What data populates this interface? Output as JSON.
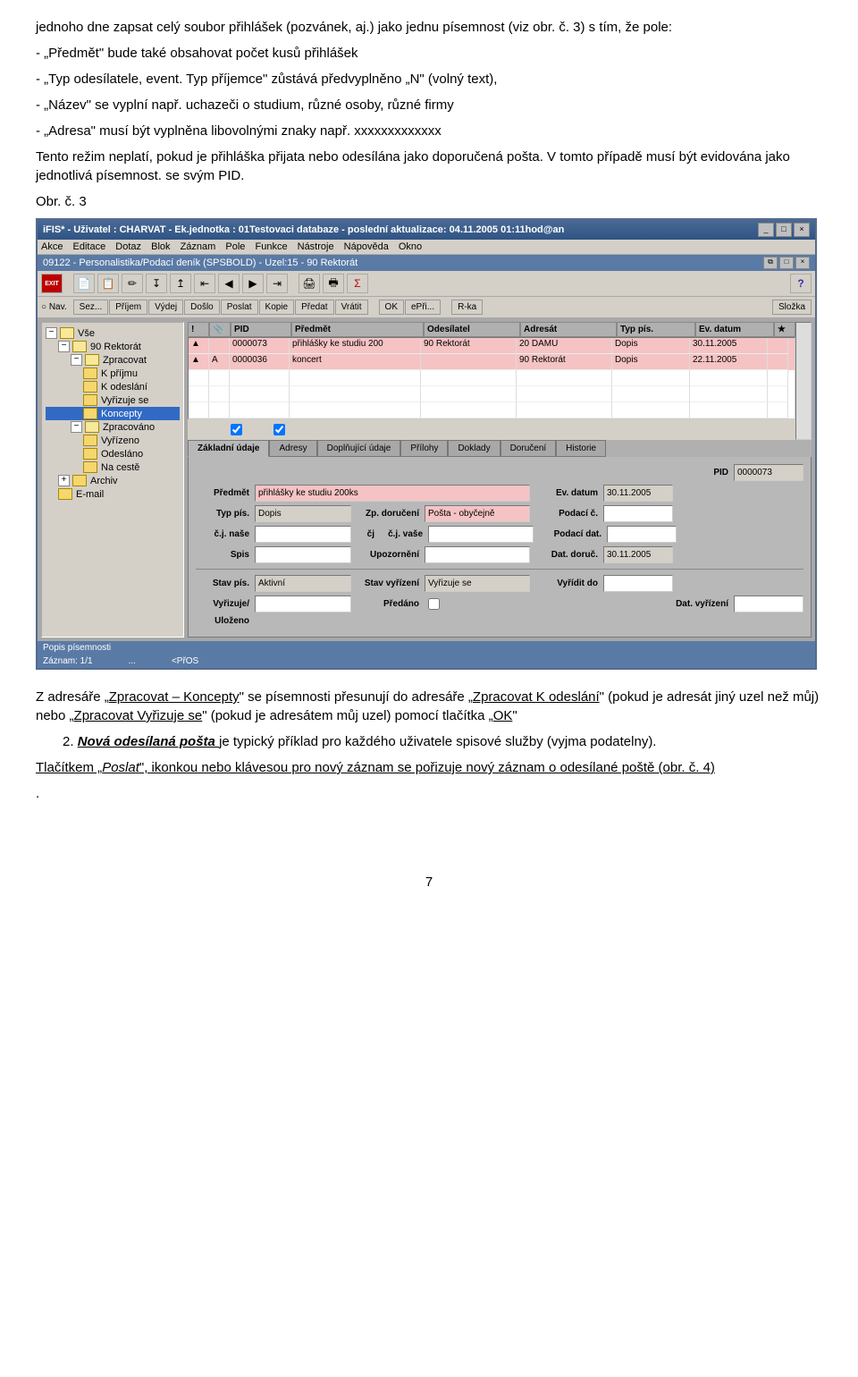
{
  "doc": {
    "p1": "jednoho dne zapsat celý soubor přihlášek (pozvánek, aj.) jako jednu písemnost (viz obr. č. 3) s tím, že pole:",
    "p2": "- „Předmět\" bude také obsahovat počet kusů přihlášek",
    "p3": "- „Typ odesílatele, event. Typ příjemce\" zůstává předvyplněno „N\" (volný text),",
    "p4": "- „Název\" se vyplní např. uchazeči o studium, různé osoby, různé firmy",
    "p5": "- „Adresa\" musí být vyplněna libovolnými znaky např. xxxxxxxxxxxxx",
    "p6": "Tento režim neplatí, pokud je přihláška přijata nebo odesílána jako doporučená pošta. V tomto případě musí být evidována jako jednotlivá písemnost. se svým PID.",
    "p7": "Obr. č. 3",
    "p8a": "Z adresáře „",
    "p8b": "Zpracovat – Koncepty",
    "p8c": "\" se písemnosti přesunují do adresáře „",
    "p8d": "Zpracovat K odeslání",
    "p8e": "\" (pokud je adresát jiný uzel než můj) nebo „",
    "p8f": "Zpracovat Vyřizuje se",
    "p8g": "\" (pokud je adresátem můj uzel) pomocí tlačítka „",
    "p8h": "OK",
    "p8i": "\"",
    "p9a": "2. ",
    "p9b": "Nová odesílaná pošta ",
    "p9c": "je typický příklad pro každého uživatele spisové služby (vyjma podatelny).",
    "p10a": "Tlačítkem „",
    "p10b": "Poslat",
    "p10c": "\", ikonkou nebo klávesou pro nový záznam se pořizuje nový záznam o odesílané poště (obr. č. 4)",
    "p11": ".",
    "pagenum": "7"
  },
  "app": {
    "title": "iFIS* - Uživatel : CHARVAT - Ek.jednotka : 01Testovaci databaze - poslední aktualizace: 04.11.2005 01:11hod@an",
    "menu": [
      "Akce",
      "Editace",
      "Dotaz",
      "Blok",
      "Záznam",
      "Pole",
      "Funkce",
      "Nástroje",
      "Nápověda",
      "Okno"
    ],
    "subtitle": "09122 - Personalistika/Podací deník (SPSBOLD) - Uzel:15 - 90 Rektorát",
    "nav_label": "Nav.",
    "actions": [
      "Sez...",
      "Příjem",
      "Výdej",
      "Došlo",
      "Poslat",
      "Kopie",
      "Předat",
      "Vrátit",
      "OK",
      "ePři...",
      "R-ka",
      "Složka"
    ],
    "tree": {
      "root": "Vše",
      "n1": "90 Rektorát",
      "n2": "Zpracovat",
      "n2a": "K příjmu",
      "n2b": "K odeslání",
      "n2c": "Vyřizuje se",
      "n2d": "Koncepty",
      "n3": "Zpracováno",
      "n3a": "Vyřízeno",
      "n3b": "Odesláno",
      "n3c": "Na cestě",
      "n4": "Archiv",
      "n5": "E-mail"
    },
    "grid": {
      "headers": {
        "warn": "!",
        "clip": "📎",
        "pid": "PID",
        "pred": "Předmět",
        "odes": "Odesílatel",
        "adr": "Adresát",
        "typ": "Typ pís.",
        "ev": "Ev. datum",
        "star": "★"
      },
      "rows": [
        {
          "warn": "▲",
          "clip": "",
          "pid": "0000073",
          "pred": "přihlášky ke studiu 200",
          "odes": "90 Rektorát",
          "adr": "20 DAMU",
          "typ": "Dopis",
          "ev": "30.11.2005"
        },
        {
          "warn": "▲",
          "clip": "A",
          "pid": "0000036",
          "pred": "koncert",
          "odes": "",
          "adr": "90 Rektorát",
          "typ": "Dopis",
          "ev": "22.11.2005"
        }
      ]
    },
    "tabs": [
      "Základní údaje",
      "Adresy",
      "Doplňující údaje",
      "Přílohy",
      "Doklady",
      "Doručení",
      "Historie"
    ],
    "form": {
      "l_pid": "PID",
      "v_pid": "0000073",
      "l_predmet": "Předmět",
      "v_predmet": "přihlášky ke studiu 200ks",
      "l_evdatum": "Ev. datum",
      "v_evdatum": "30.11.2005",
      "l_typpis": "Typ pís.",
      "v_typpis": "Dopis",
      "l_zpdor": "Zp. doručení",
      "v_zpdor": "Pošta - obyčejně",
      "l_podacic": "Podací č.",
      "v_podacic": "",
      "l_cjnase": "č.j. naše",
      "v_cjnase": "",
      "l_cj": "čj",
      "l_cjvase": "č.j. vaše",
      "v_cjvase": "",
      "l_podacidat": "Podací dat.",
      "v_podacidat": "",
      "l_spis": "Spis",
      "v_spis": "",
      "l_upozorneni": "Upozornění",
      "v_upozorneni": "",
      "l_datdoruc": "Dat. doruč.",
      "v_datdoruc": "30.11.2005",
      "l_stavpis": "Stav pís.",
      "v_stavpis": "Aktivní",
      "l_stavvyr": "Stav vyřízení",
      "v_stavvyr": "Vyřizuje se",
      "l_vyriditdo": "Vyřídit do",
      "v_vyriditdo": "",
      "l_vyrizuje": "Vyřizuje/",
      "v_vyrizuje": "",
      "l_ulozeno": "Uloženo",
      "l_predano": "Předáno",
      "l_datvyr": "Dat. vyřízení",
      "v_datvyr": ""
    },
    "status": {
      "s1": "Popis písemnosti",
      "s2": "Záznam: 1/1",
      "s3": "...",
      "s4": "<PřOS"
    }
  }
}
